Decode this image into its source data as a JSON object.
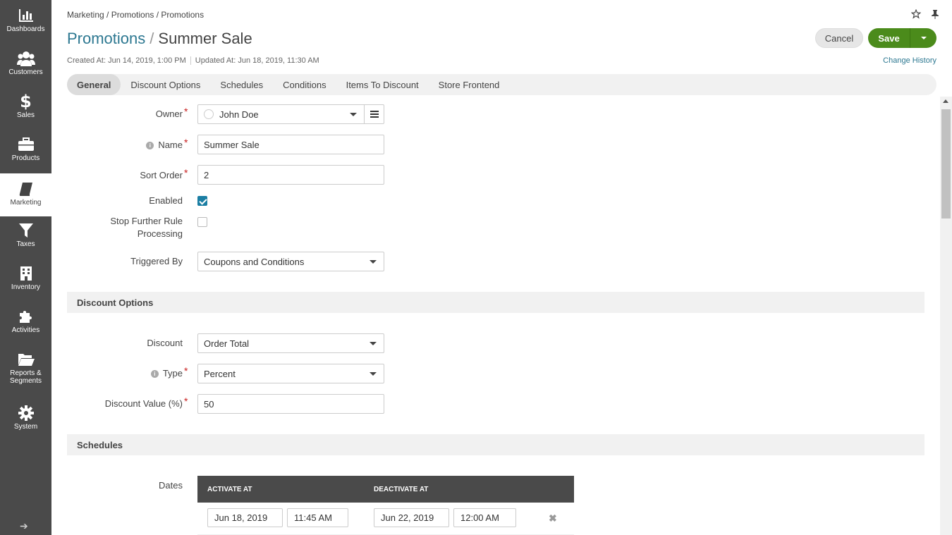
{
  "sidebar": {
    "items": [
      {
        "label": "Dashboards"
      },
      {
        "label": "Customers"
      },
      {
        "label": "Sales"
      },
      {
        "label": "Products"
      },
      {
        "label": "Marketing"
      },
      {
        "label": "Taxes"
      },
      {
        "label": "Inventory"
      },
      {
        "label": "Activities"
      },
      {
        "label": "Reports &\nSegments"
      },
      {
        "label": "System"
      }
    ],
    "active": "Marketing"
  },
  "header": {
    "breadcrumb": "Marketing / Promotions / Promotions",
    "title_parent": "Promotions",
    "title_sep": "/",
    "title_entity": "Summer Sale",
    "created_at": "Created At: Jun 14, 2019, 1:00 PM",
    "updated_at": "Updated At: Jun 18, 2019, 11:30 AM",
    "cancel_label": "Cancel",
    "save_label": "Save",
    "change_history": "Change History"
  },
  "tabs": [
    {
      "label": "General",
      "active": true
    },
    {
      "label": "Discount Options"
    },
    {
      "label": "Schedules"
    },
    {
      "label": "Conditions"
    },
    {
      "label": "Items To Discount"
    },
    {
      "label": "Store Frontend"
    }
  ],
  "general": {
    "owner_label": "Owner",
    "owner_value": "John Doe",
    "name_label": "Name",
    "name_value": "Summer Sale",
    "sort_order_label": "Sort Order",
    "sort_order_value": "2",
    "enabled_label": "Enabled",
    "enabled_checked": true,
    "stop_label_1": "Stop Further Rule",
    "stop_label_2": "Processing",
    "stop_checked": false,
    "triggered_by_label": "Triggered By",
    "triggered_by_value": "Coupons and Conditions"
  },
  "discount_options": {
    "section_title": "Discount Options",
    "discount_label": "Discount",
    "discount_value": "Order Total",
    "type_label": "Type",
    "type_value": "Percent",
    "discount_value_label": "Discount Value (%)",
    "discount_value_value": "50"
  },
  "schedules": {
    "section_title": "Schedules",
    "dates_label": "Dates",
    "col_activate": "ACTIVATE AT",
    "col_deactivate": "DEACTIVATE AT",
    "rows": [
      {
        "activate_date": "Jun 18, 2019",
        "activate_time": "11:45 AM",
        "deactivate_date": "Jun 22, 2019",
        "deactivate_time": "12:00 AM"
      }
    ]
  },
  "colors": {
    "sidebar_bg": "#4a4a4a",
    "accent": "#2d7891",
    "save_green": "#4b8b1b",
    "required": "#c81e1e",
    "checkbox": "#1b7ea3"
  }
}
